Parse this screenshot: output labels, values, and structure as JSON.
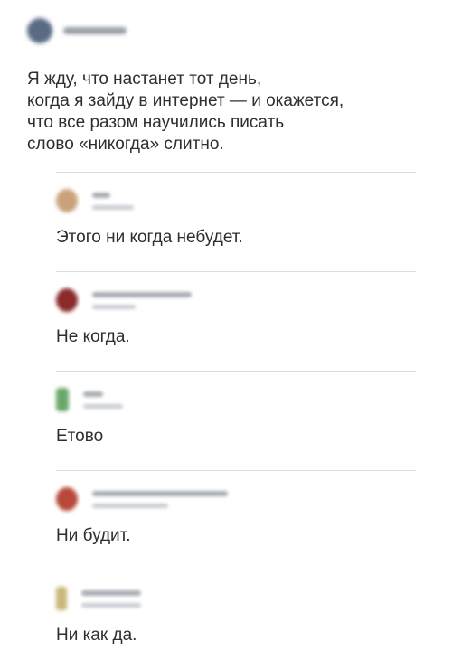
{
  "post": {
    "text": "Я жду, что настанет тот день,\nкогда я зайду в интернет — и окажется,\nчто все разом научились писать\nслово «никогда» слитно.",
    "avatar_color": "#5a6a82"
  },
  "comments": [
    {
      "text": "Этого ни когда небудет.",
      "avatar_color": "#c9a27a"
    },
    {
      "text": "Не когда.",
      "avatar_color": "#8a2a2a"
    },
    {
      "text": "Етово",
      "avatar_color": "#6aa86a"
    },
    {
      "text": "Ни будит.",
      "avatar_color": "#b8483a"
    },
    {
      "text": "Ни как да.",
      "avatar_color": "#c8b878"
    }
  ]
}
